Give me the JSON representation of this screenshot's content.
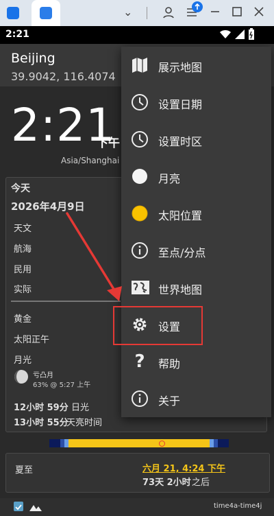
{
  "status_bar": {
    "time": "2:21"
  },
  "location": {
    "city": "Beijing",
    "coords": "39.9042, 116.4074"
  },
  "clock": {
    "time": "2:21",
    "ampm": "下午",
    "timezone": "Asia/Shanghai"
  },
  "day": {
    "label": "今天",
    "date": "2026年4月9日",
    "twilight": [
      "天文",
      "航海",
      "民用",
      "实际"
    ],
    "sun_rows": [
      "黄金",
      "太阳正午",
      "月光"
    ],
    "moon_phase": "亏凸月",
    "moon_detail": "63% @ 5:27 上午",
    "daylight_value": "12小时 59分",
    "daylight_label": "日光",
    "bright_value": "13小时 55分",
    "bright_label": "天亮时间"
  },
  "solstice": {
    "label": "夏至",
    "date_text": "六月 21, 4:24 下午",
    "countdown_value": "73天 2小时",
    "countdown_suffix": "之后"
  },
  "footer": {
    "tag": "time4a-time4j"
  },
  "menu": {
    "items": [
      {
        "label": "展示地图",
        "icon": "map-icon"
      },
      {
        "label": "设置日期",
        "icon": "clock-icon"
      },
      {
        "label": "设置时区",
        "icon": "clock-icon"
      },
      {
        "label": "月亮",
        "icon": "moon-icon"
      },
      {
        "label": "太阳位置",
        "icon": "sun-icon"
      },
      {
        "label": "至点/分点",
        "icon": "info-icon"
      },
      {
        "label": "世界地图",
        "icon": "world-map-icon"
      },
      {
        "label": "设置",
        "icon": "gear-icon"
      },
      {
        "label": "帮助",
        "icon": "help-icon"
      },
      {
        "label": "关于",
        "icon": "info-icon"
      }
    ]
  },
  "colors": {
    "accent_yellow": "#f5c518",
    "highlight_red": "#e53935",
    "timeline_dark": "#0b1a5a"
  }
}
